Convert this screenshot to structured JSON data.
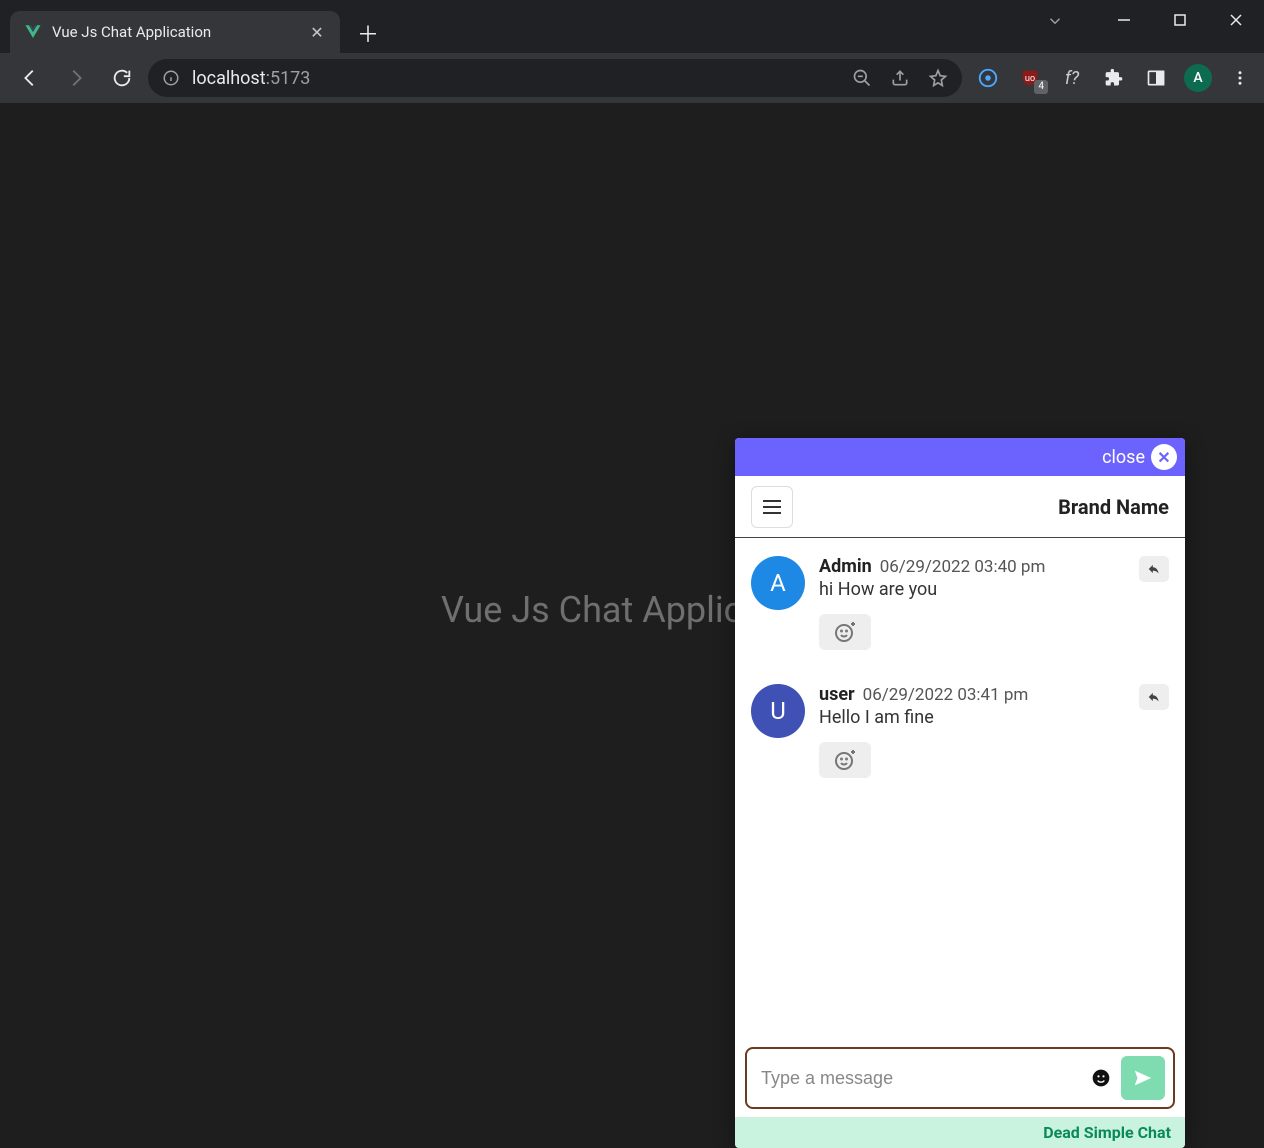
{
  "browser": {
    "tab_title": "Vue Js Chat Application",
    "url_host": "localhost",
    "url_rest": ":5173",
    "avatar_initial": "A",
    "ext_badge": "4"
  },
  "page": {
    "heading": "Vue Js Chat Application"
  },
  "chat": {
    "close_label": "close",
    "brand": "Brand Name",
    "input_placeholder": "Type a message",
    "footer": "Dead Simple Chat",
    "messages": [
      {
        "sender": "Admin",
        "timestamp": "06/29/2022 03:40 pm",
        "text": "hi How are you",
        "avatar_initial": "A",
        "avatar_color": "#1e88e5"
      },
      {
        "sender": "user",
        "timestamp": "06/29/2022 03:41 pm",
        "text": "Hello I am fine",
        "avatar_initial": "U",
        "avatar_color": "#3f51b5"
      }
    ]
  }
}
